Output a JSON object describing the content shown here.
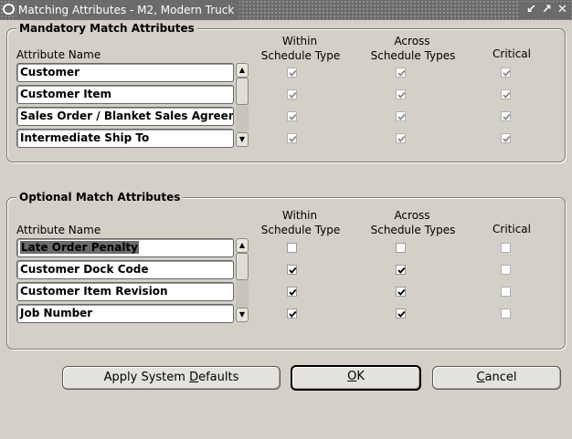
{
  "window": {
    "title": "Matching Attributes - M2, Modern Truck"
  },
  "mandatory": {
    "title": "Mandatory Match Attributes",
    "col_name": "Attribute Name",
    "col_within_1": "Within",
    "col_within_2": "Schedule Type",
    "col_across_1": "Across",
    "col_across_2": "Schedule Types",
    "col_critical": "Critical",
    "rows": [
      {
        "name": "Customer",
        "within": true,
        "across": true,
        "critical": true
      },
      {
        "name": "Customer Item",
        "within": true,
        "across": true,
        "critical": true
      },
      {
        "name": "Sales Order / Blanket Sales Agreement",
        "within": true,
        "across": true,
        "critical": true
      },
      {
        "name": "Intermediate Ship To",
        "within": true,
        "across": true,
        "critical": true
      }
    ]
  },
  "optional": {
    "title": "Optional Match Attributes",
    "col_name": "Attribute Name",
    "col_within_1": "Within",
    "col_within_2": "Schedule Type",
    "col_across_1": "Across",
    "col_across_2": "Schedule Types",
    "col_critical": "Critical",
    "rows": [
      {
        "name": "Late Order Penalty",
        "within": false,
        "across": false,
        "critical": false
      },
      {
        "name": "Customer Dock Code",
        "within": true,
        "across": true,
        "critical": false
      },
      {
        "name": "Customer Item Revision",
        "within": true,
        "across": true,
        "critical": false
      },
      {
        "name": "Job Number",
        "within": true,
        "across": true,
        "critical": false
      }
    ]
  },
  "buttons": {
    "apply_pre": "Apply System ",
    "apply_u": "D",
    "apply_post": "efaults",
    "ok_u": "O",
    "ok_post": "K",
    "cancel_u": "C",
    "cancel_post": "ancel"
  }
}
